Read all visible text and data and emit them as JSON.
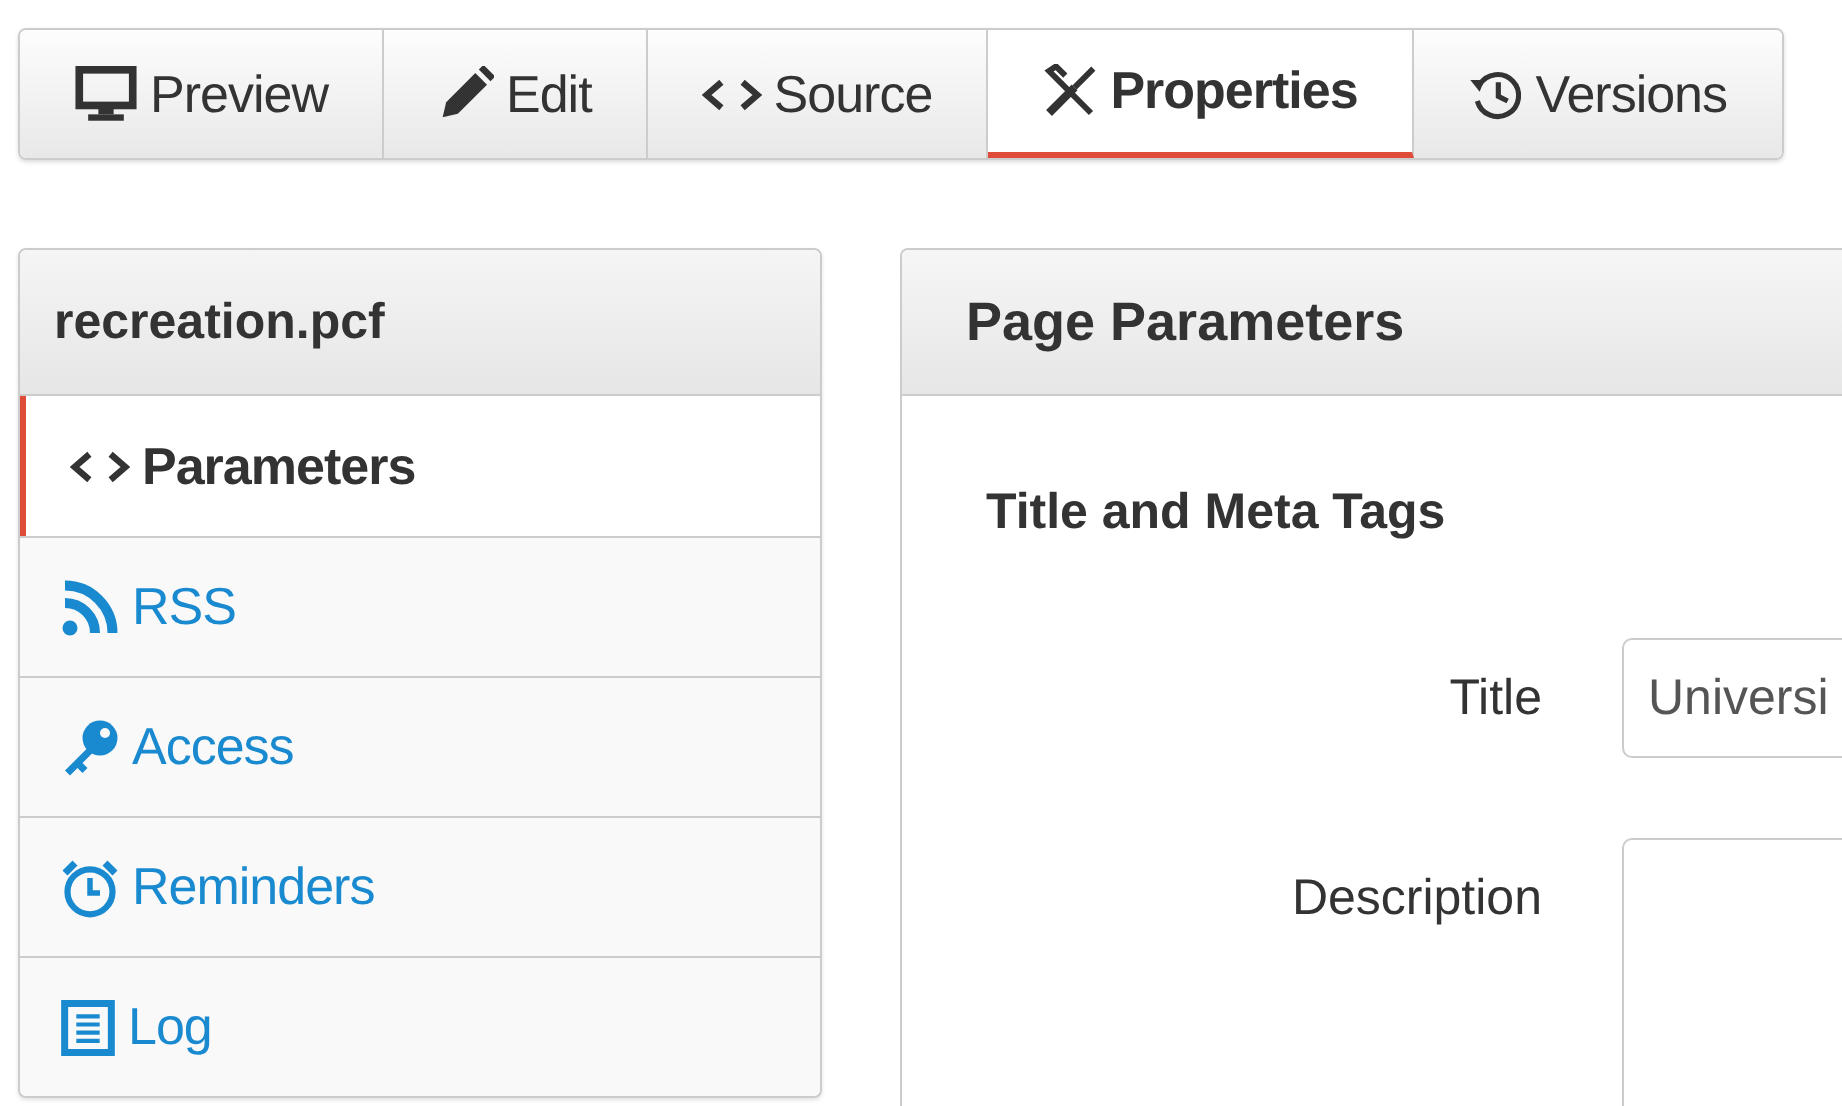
{
  "tabs": [
    {
      "label": "Preview",
      "selected": false
    },
    {
      "label": "Edit",
      "selected": false
    },
    {
      "label": "Source",
      "selected": false
    },
    {
      "label": "Properties",
      "selected": true
    },
    {
      "label": "Versions",
      "selected": false
    }
  ],
  "sidebar": {
    "title": "recreation.pcf",
    "items": [
      {
        "label": "Parameters",
        "selected": true
      },
      {
        "label": "RSS",
        "selected": false
      },
      {
        "label": "Access",
        "selected": false
      },
      {
        "label": "Reminders",
        "selected": false
      },
      {
        "label": "Log",
        "selected": false
      }
    ]
  },
  "panel": {
    "title": "Page Parameters",
    "section": "Title and Meta Tags",
    "fields": [
      {
        "kind": "text",
        "label": "Title",
        "value": "Universi"
      },
      {
        "kind": "textarea",
        "label": "Description"
      }
    ]
  }
}
